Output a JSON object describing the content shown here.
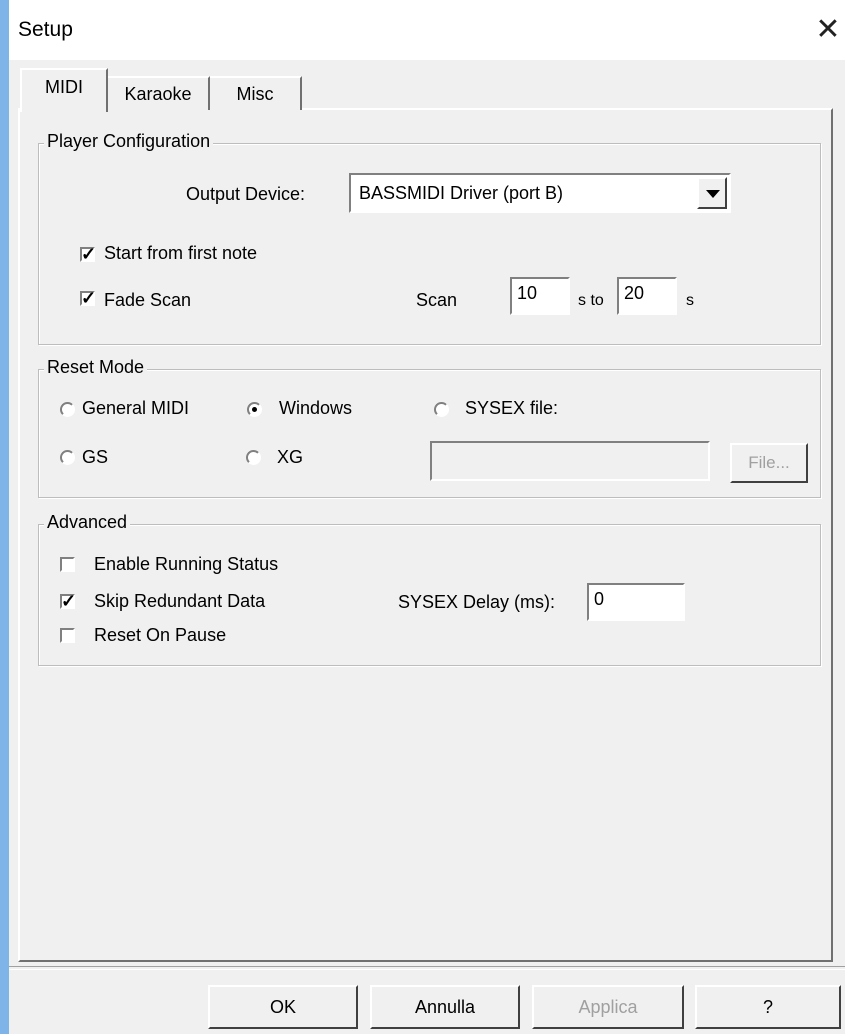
{
  "window": {
    "title": "Setup",
    "close_glyph": "✕"
  },
  "tabs": [
    {
      "label": "MIDI",
      "active": true
    },
    {
      "label": "Karaoke",
      "active": false
    },
    {
      "label": "Misc",
      "active": false
    }
  ],
  "player_config": {
    "title": "Player Configuration",
    "output_device_label": "Output Device:",
    "output_device_value": "BASSMIDI Driver (port B)",
    "start_from_first_note": {
      "label": "Start from first note",
      "checked": true
    },
    "fade_scan": {
      "label": "Fade Scan",
      "checked": true
    },
    "scan_label": "Scan",
    "scan_from": "10",
    "scan_to_label": "s to",
    "scan_to": "20",
    "scan_unit": "s"
  },
  "reset_mode": {
    "title": "Reset Mode",
    "options": {
      "general_midi": {
        "label": "General MIDI",
        "selected": false
      },
      "windows": {
        "label": "Windows",
        "selected": true
      },
      "sysex_file": {
        "label": "SYSEX file:",
        "selected": false
      },
      "gs": {
        "label": "GS",
        "selected": false
      },
      "xg": {
        "label": "XG",
        "selected": false
      }
    },
    "sysex_file_value": "",
    "file_button": "File..."
  },
  "advanced": {
    "title": "Advanced",
    "enable_running_status": {
      "label": "Enable Running Status",
      "checked": false
    },
    "skip_redundant_data": {
      "label": "Skip Redundant Data",
      "checked": true
    },
    "reset_on_pause": {
      "label": "Reset On Pause",
      "checked": false
    },
    "sysex_delay_label": "SYSEX Delay (ms):",
    "sysex_delay_value": "0"
  },
  "footer": {
    "ok": "OK",
    "cancel": "Annulla",
    "apply": "Applica",
    "help": "?"
  },
  "colors": {
    "window_accent": "#7eb4e8",
    "dialog_bg": "#f0f0f0",
    "disabled_text": "#a0a0a0"
  }
}
